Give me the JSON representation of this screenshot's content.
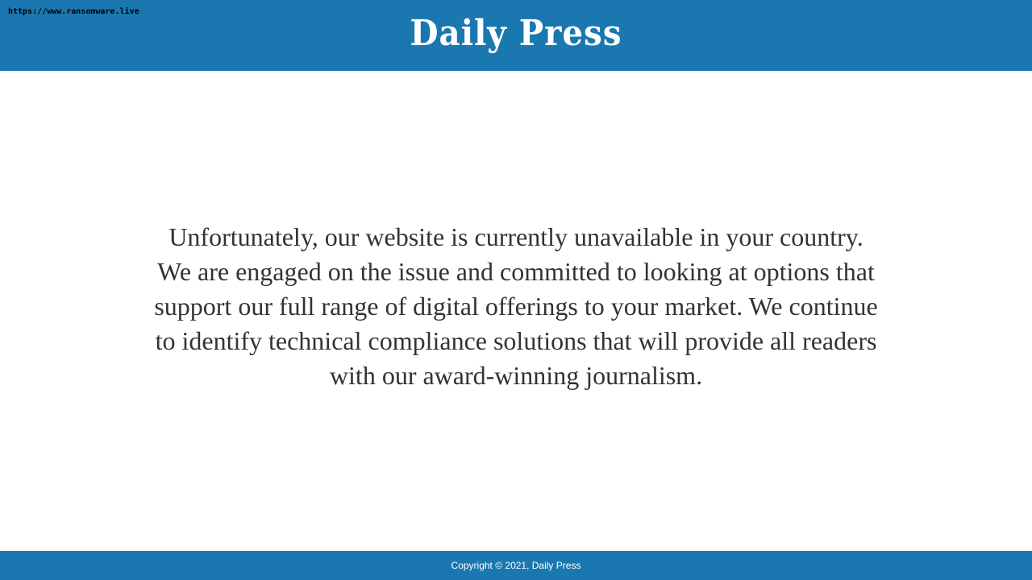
{
  "colors": {
    "brand": "#1a77b0",
    "text": "#333333",
    "background": "#ffffff"
  },
  "watermark": {
    "text": "https://www.ransomware.live"
  },
  "header": {
    "logo_text": "Daily Press"
  },
  "main": {
    "message": "Unfortunately, our website is currently unavailable in your country. We are engaged on the issue and committed to looking at options that support our full range of digital offerings to your market. We continue to identify technical compliance solutions that will provide all readers with our award-winning journalism."
  },
  "footer": {
    "copyright": "Copyright © 2021, Daily Press"
  }
}
